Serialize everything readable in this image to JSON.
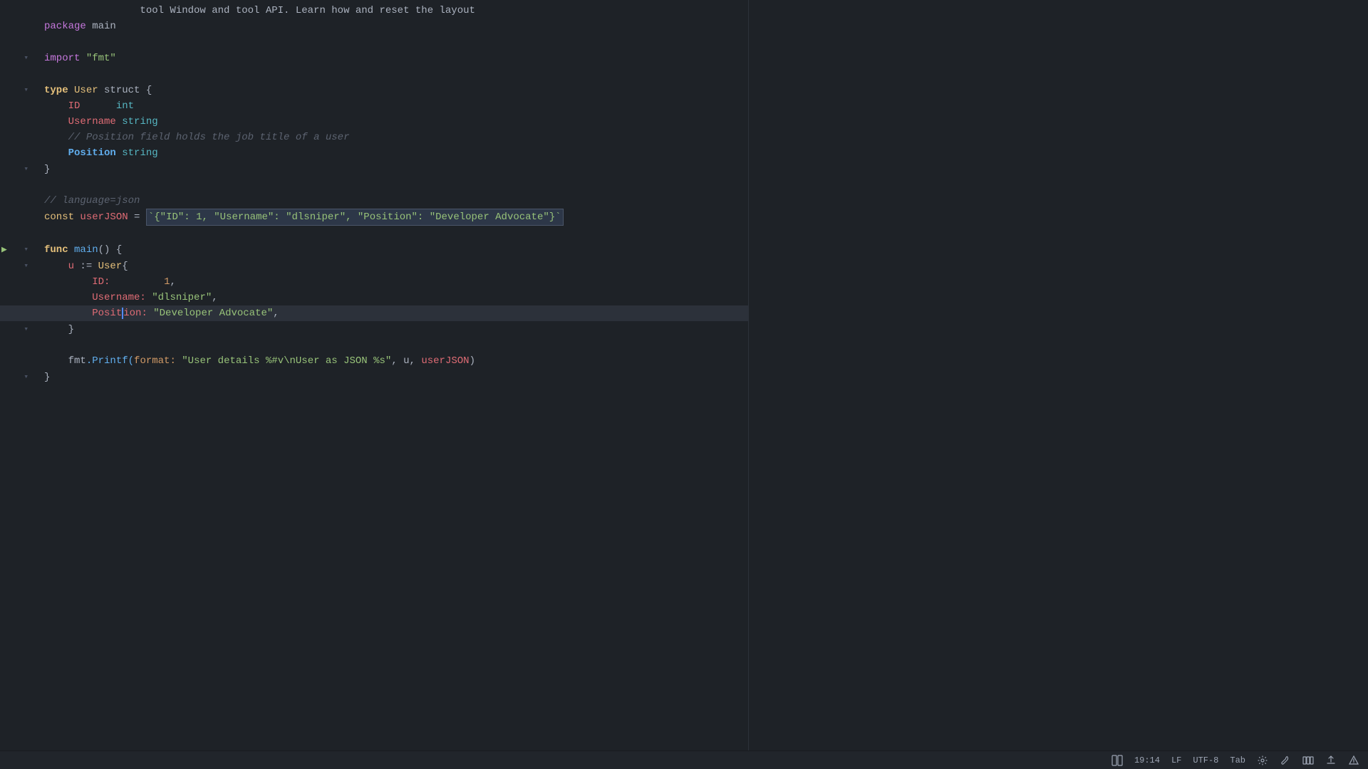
{
  "editor": {
    "background": "#1e2227",
    "lines": [
      {
        "num": "",
        "type": "code",
        "tokens": [
          {
            "text": "package",
            "class": "kw-package"
          },
          {
            "text": " main",
            "class": "plain"
          }
        ]
      },
      {
        "num": "",
        "type": "blank"
      },
      {
        "num": "",
        "type": "code",
        "hasFold": true,
        "tokens": [
          {
            "text": "import",
            "class": "kw-import"
          },
          {
            "text": " ",
            "class": "plain"
          },
          {
            "text": "\"fmt\"",
            "class": "string"
          }
        ]
      },
      {
        "num": "",
        "type": "blank"
      },
      {
        "num": "",
        "type": "code",
        "hasFold": true,
        "tokens": [
          {
            "text": "type",
            "class": "kw-type"
          },
          {
            "text": " ",
            "class": "plain"
          },
          {
            "text": "User",
            "class": "type-name"
          },
          {
            "text": " struct {",
            "class": "plain"
          }
        ]
      },
      {
        "num": "",
        "type": "code",
        "indent": 2,
        "tokens": [
          {
            "text": "ID",
            "class": "field-name"
          },
          {
            "text": "       int",
            "class": "type-prim"
          }
        ]
      },
      {
        "num": "",
        "type": "code",
        "indent": 2,
        "tokens": [
          {
            "text": "Username",
            "class": "field-name"
          },
          {
            "text": " string",
            "class": "type-prim"
          }
        ]
      },
      {
        "num": "",
        "type": "code",
        "indent": 2,
        "tokens": [
          {
            "text": "// Position field holds the job title of a user",
            "class": "comment"
          }
        ]
      },
      {
        "num": "",
        "type": "code",
        "indent": 2,
        "tokens": [
          {
            "text": "Position",
            "class": "position-field"
          },
          {
            "text": " string",
            "class": "type-prim"
          }
        ]
      },
      {
        "num": "",
        "type": "code",
        "hasFold": true,
        "tokens": [
          {
            "text": "}",
            "class": "plain"
          }
        ]
      },
      {
        "num": "",
        "type": "blank"
      },
      {
        "num": "",
        "type": "code",
        "tokens": [
          {
            "text": "// language=json",
            "class": "comment"
          }
        ]
      },
      {
        "num": "",
        "type": "code",
        "tokens": [
          {
            "text": "const",
            "class": "kw-const"
          },
          {
            "text": " ",
            "class": "plain"
          },
          {
            "text": "userJSON",
            "class": "kw-var-name"
          },
          {
            "text": " = ",
            "class": "plain"
          },
          {
            "text": "`{\"ID\": 1, \"Username\": \"dlsniper\", \"Position\": \"Developer Advocate\"}`",
            "class": "string",
            "highlight": true
          }
        ]
      },
      {
        "num": "",
        "type": "blank"
      },
      {
        "num": "",
        "type": "code",
        "hasFold": true,
        "hasRun": true,
        "tokens": [
          {
            "text": "func",
            "class": "kw-func"
          },
          {
            "text": " ",
            "class": "plain"
          },
          {
            "text": "main",
            "class": "func-call"
          },
          {
            "text": "() {",
            "class": "plain"
          }
        ]
      },
      {
        "num": "",
        "type": "code",
        "indent": 1,
        "hasFold": true,
        "tokens": [
          {
            "text": "u",
            "class": "kw-var-name"
          },
          {
            "text": " := ",
            "class": "plain"
          },
          {
            "text": "User",
            "class": "type-name"
          },
          {
            "text": "{",
            "class": "plain"
          }
        ]
      },
      {
        "num": "",
        "type": "code",
        "indent": 2,
        "tokens": [
          {
            "text": "ID:",
            "class": "field-name"
          },
          {
            "text": "         ",
            "class": "plain"
          },
          {
            "text": "1",
            "class": "number"
          },
          {
            "text": ",",
            "class": "plain"
          }
        ]
      },
      {
        "num": "",
        "type": "code",
        "indent": 2,
        "tokens": [
          {
            "text": "Username:",
            "class": "field-name"
          },
          {
            "text": " ",
            "class": "plain"
          },
          {
            "text": "\"dlsniper\"",
            "class": "string"
          },
          {
            "text": ",",
            "class": "plain"
          }
        ]
      },
      {
        "num": "",
        "type": "code",
        "indent": 2,
        "isCursorLine": true,
        "tokens": [
          {
            "text": "Posit",
            "class": "field-name"
          },
          {
            "text": "ion:",
            "class": "field-name"
          },
          {
            "text": " ",
            "class": "plain"
          },
          {
            "text": "\"Developer Advocate\"",
            "class": "string"
          },
          {
            "text": ",",
            "class": "plain"
          }
        ],
        "cursorAfter": 5
      },
      {
        "num": "",
        "type": "code",
        "indent": 1,
        "hasFold": true,
        "tokens": [
          {
            "text": "}",
            "class": "plain"
          }
        ]
      },
      {
        "num": "",
        "type": "blank"
      },
      {
        "num": "",
        "type": "code",
        "indent": 1,
        "tokens": [
          {
            "text": "fmt",
            "class": "plain"
          },
          {
            "text": ".Printf(",
            "class": "func-call"
          },
          {
            "text": "format:",
            "class": "param-name"
          },
          {
            "text": " ",
            "class": "plain"
          },
          {
            "text": "\"User details %#v\\nUser as JSON %s\"",
            "class": "string"
          },
          {
            "text": ", u, ",
            "class": "plain"
          },
          {
            "text": "userJSON",
            "class": "kw-var-name"
          },
          {
            "text": ")",
            "class": "plain"
          }
        ]
      },
      {
        "num": "",
        "type": "code",
        "hasFold": true,
        "tokens": [
          {
            "text": "}",
            "class": "plain"
          }
        ]
      }
    ],
    "startLine": 1
  },
  "statusBar": {
    "position": "19:14",
    "lineEnding": "LF",
    "encoding": "UTF-8",
    "indent": "Tab",
    "icons": [
      "layout",
      "settings",
      "wrench",
      "columns",
      "upload",
      "warning"
    ]
  }
}
